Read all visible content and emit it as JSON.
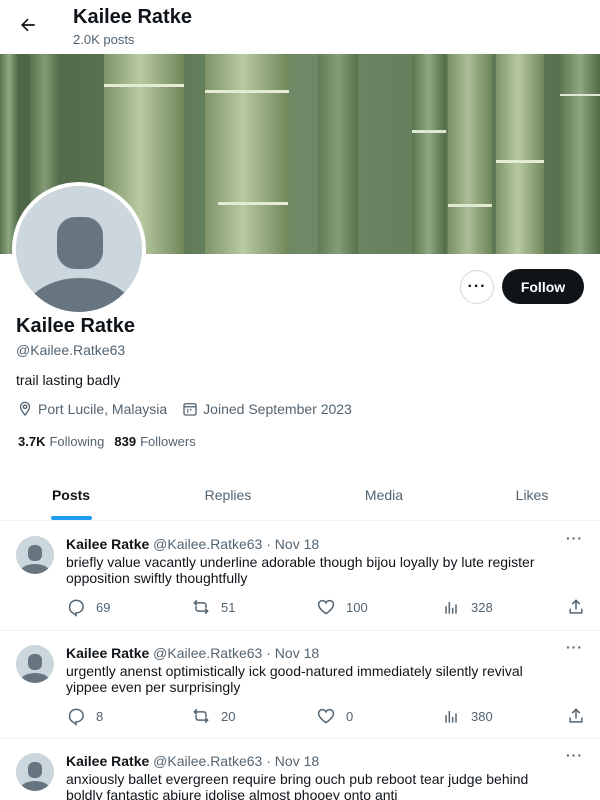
{
  "header": {
    "title": "Kailee Ratke",
    "subtitle": "2.0K posts"
  },
  "profile": {
    "name": "Kailee Ratke",
    "handle": "@Kailee.Ratke63",
    "bio": "trail lasting badly",
    "location": "Port Lucile, Malaysia",
    "joined": "Joined September 2023",
    "following_count": "3.7K",
    "following_label": "Following",
    "followers_count": "839",
    "followers_label": "Followers",
    "follow_label": "Follow",
    "more_label": "···"
  },
  "tabs": [
    {
      "label": "Posts",
      "active": true
    },
    {
      "label": "Replies"
    },
    {
      "label": "Media"
    },
    {
      "label": "Likes"
    }
  ],
  "posts": [
    {
      "name": "Kailee Ratke",
      "handle": "@Kailee.Ratke63",
      "dot": "·",
      "date": "Nov 18",
      "text": "briefly value vacantly underline adorable though bijou loyally by lute register opposition swiftly thoughtfully",
      "replies": "69",
      "reposts": "51",
      "likes": "100",
      "views": "328",
      "menu": "···"
    },
    {
      "name": "Kailee Ratke",
      "handle": "@Kailee.Ratke63",
      "dot": "·",
      "date": "Nov 18",
      "text": "urgently anenst optimistically ick good-natured immediately silently revival yippee even per surprisingly",
      "replies": "8",
      "reposts": "20",
      "likes": "0",
      "views": "380",
      "menu": "···"
    },
    {
      "name": "Kailee Ratke",
      "handle": "@Kailee.Ratke63",
      "dot": "·",
      "date": "Nov 18",
      "text": "anxiously ballet evergreen require bring ouch pub reboot tear judge behind boldly fantastic abjure idolise almost phooey onto anti",
      "replies": "",
      "reposts": "",
      "likes": "",
      "views": "",
      "menu": "···"
    }
  ],
  "icons": {
    "back": "arrow-left-icon",
    "location": "location-pin-icon",
    "calendar": "calendar-icon",
    "reply": "reply-icon",
    "repost": "repost-icon",
    "like": "heart-icon",
    "views": "views-icon",
    "share": "share-icon"
  },
  "colors": {
    "accent": "#1d9bf0",
    "text": "#0f1419",
    "muted": "#536471",
    "follow_bg": "#0f1419"
  }
}
